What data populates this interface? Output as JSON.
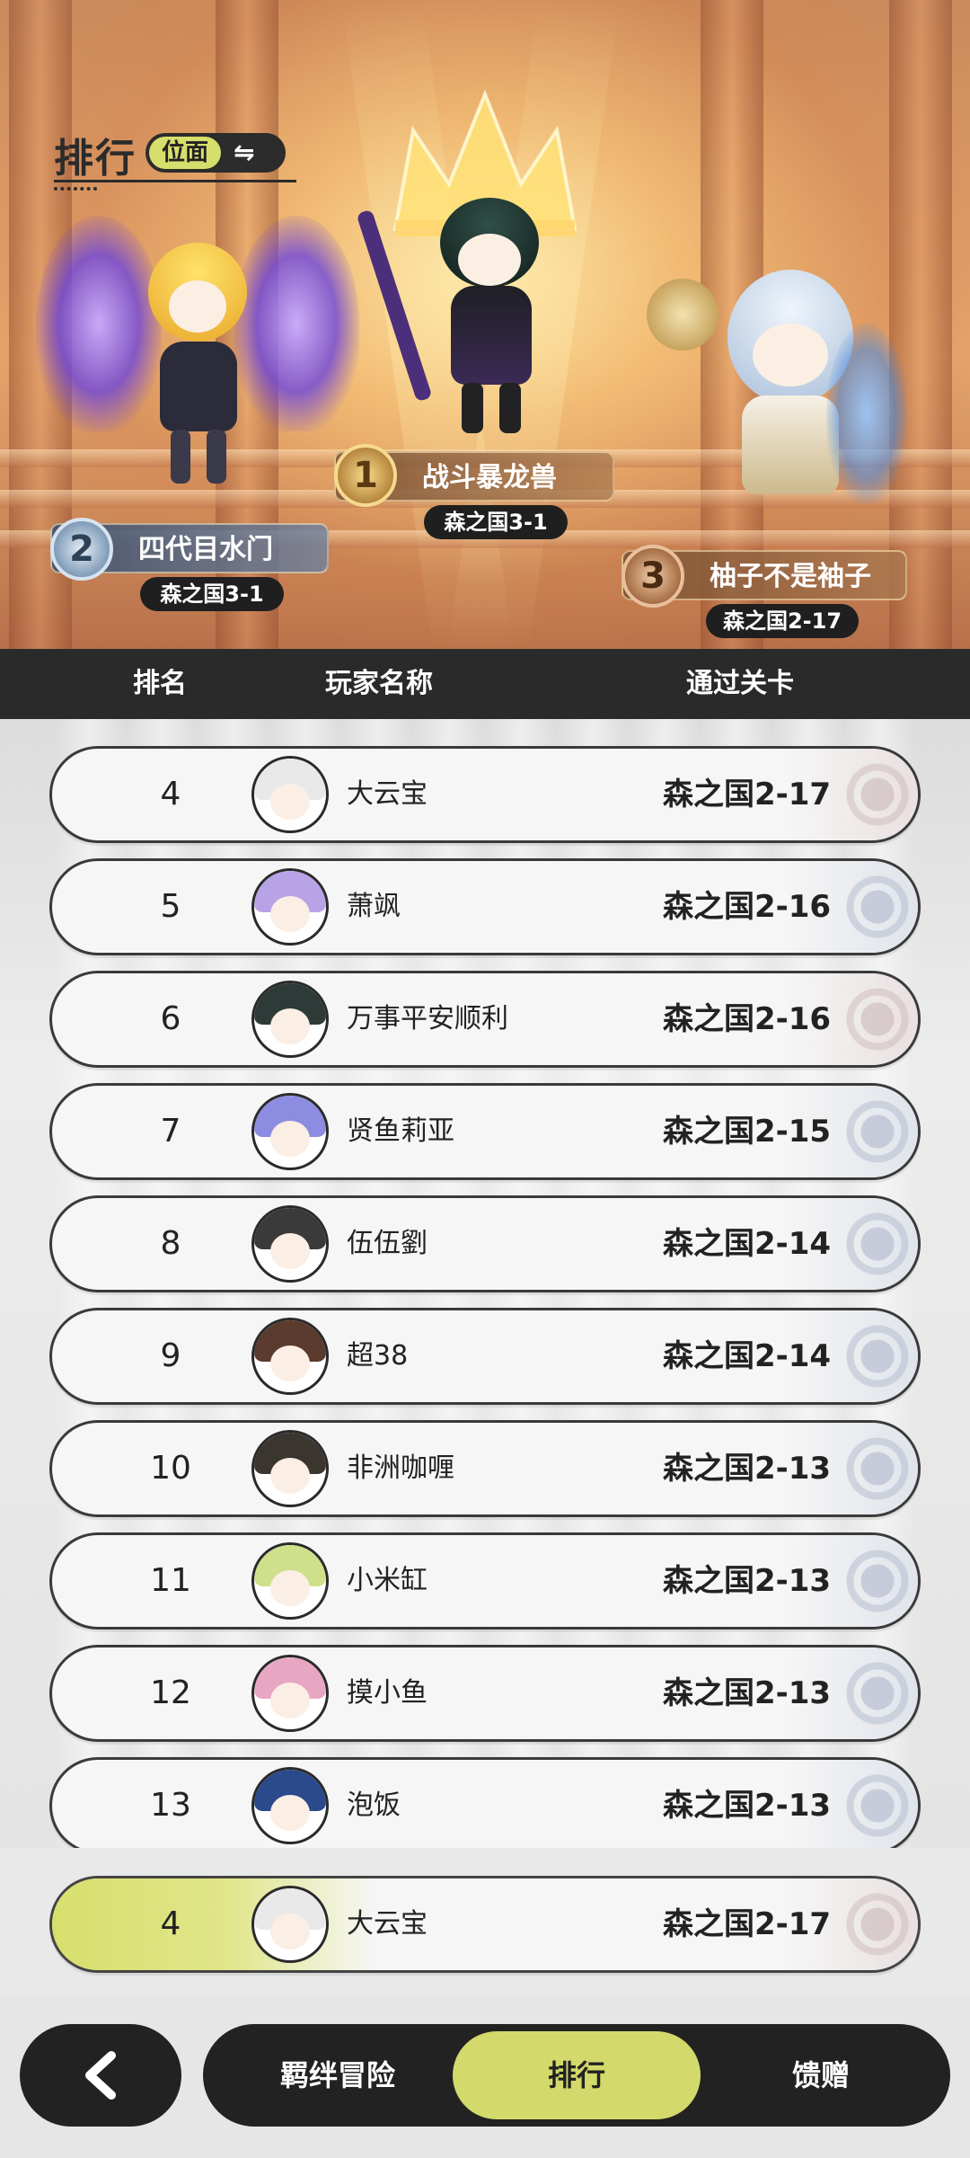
{
  "header": {
    "title": "排行",
    "scope_label": "位面",
    "swap_icon": "swap-icon"
  },
  "podium": [
    {
      "rank": "1",
      "name": "战斗暴龙兽",
      "stage": "森之国3-1"
    },
    {
      "rank": "2",
      "name": "四代目水门",
      "stage": "森之国3-1"
    },
    {
      "rank": "3",
      "name": "柚子不是袖子",
      "stage": "森之国2-17"
    }
  ],
  "table": {
    "columns": [
      "排名",
      "玩家名称",
      "通过关卡"
    ],
    "rows": [
      {
        "rank": "4",
        "name": "大云宝",
        "stage": "森之国2-17"
      },
      {
        "rank": "5",
        "name": "萧飒",
        "stage": "森之国2-16"
      },
      {
        "rank": "6",
        "name": "万事平安顺利",
        "stage": "森之国2-16"
      },
      {
        "rank": "7",
        "name": "贤鱼莉亚",
        "stage": "森之国2-15"
      },
      {
        "rank": "8",
        "name": "伍伍劉",
        "stage": "森之国2-14"
      },
      {
        "rank": "9",
        "name": "超38",
        "stage": "森之国2-14"
      },
      {
        "rank": "10",
        "name": "非洲咖喱",
        "stage": "森之国2-13"
      },
      {
        "rank": "11",
        "name": "小米缸",
        "stage": "森之国2-13"
      },
      {
        "rank": "12",
        "name": "摸小鱼",
        "stage": "森之国2-13"
      },
      {
        "rank": "13",
        "name": "泡饭",
        "stage": "森之国2-13"
      }
    ]
  },
  "my_rank": {
    "rank": "4",
    "name": "大云宝",
    "stage": "森之国2-17"
  },
  "nav": {
    "back_icon": "chevron-left-icon",
    "tabs": [
      {
        "label": "羁绊冒险",
        "active": false
      },
      {
        "label": "排行",
        "active": true
      },
      {
        "label": "馈赠",
        "active": false
      }
    ]
  },
  "colors": {
    "accent": "#d3d96a",
    "dark": "#222222",
    "row_bg": "#f6f6f6"
  }
}
